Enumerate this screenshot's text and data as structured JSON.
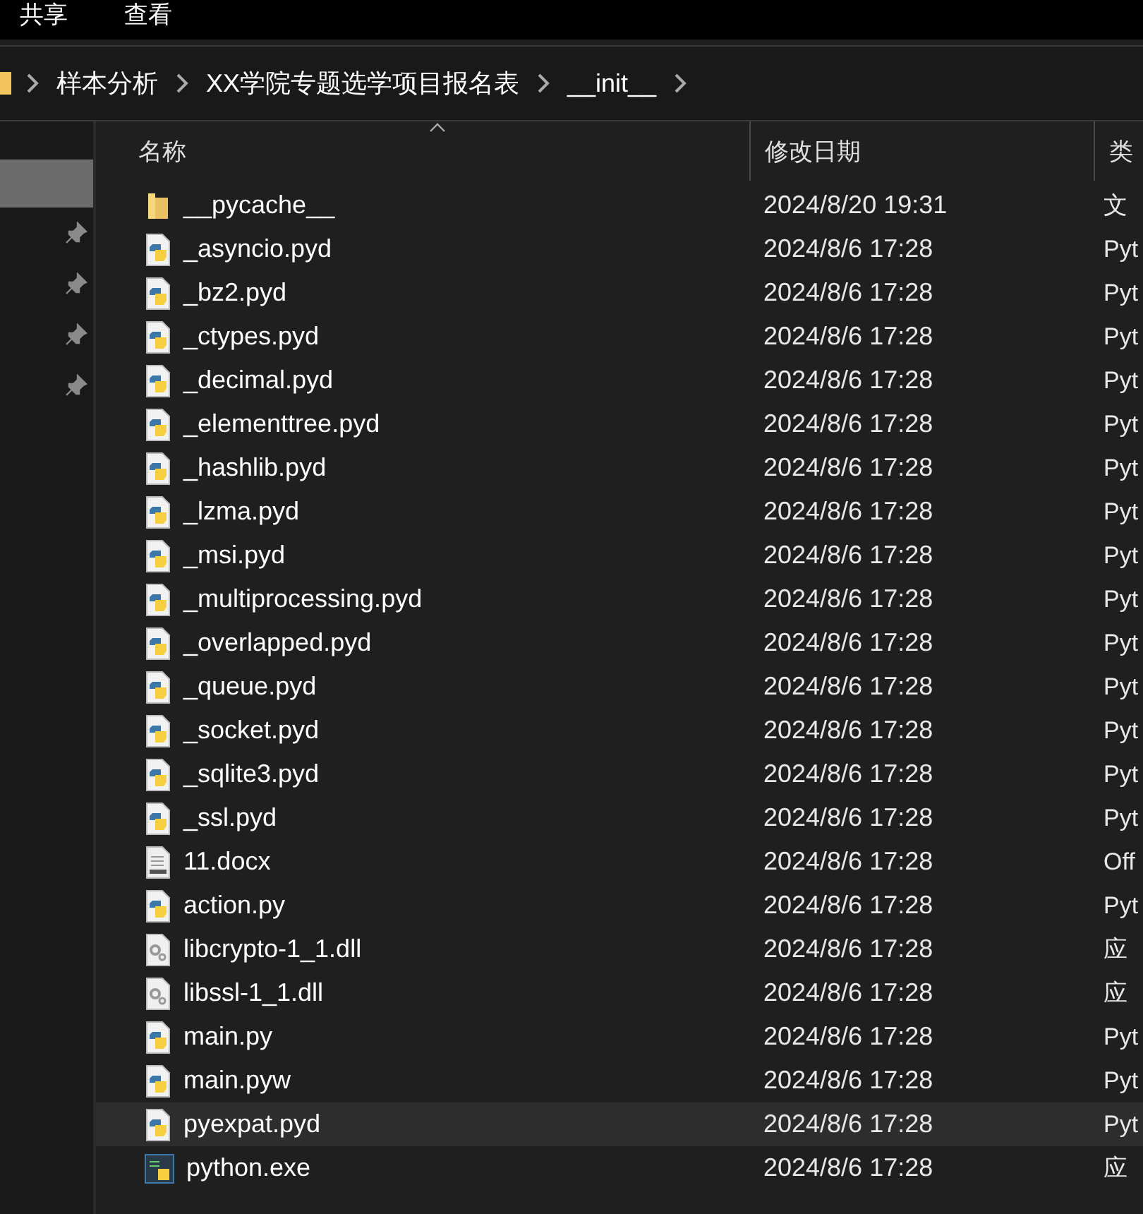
{
  "menu_bar": {
    "items": [
      "共享",
      "查看"
    ]
  },
  "breadcrumb": {
    "segments": [
      "样本分析",
      "XX学院专题选学项目报名表",
      "__init__"
    ]
  },
  "sidebar": {
    "items": [
      {
        "selected": true,
        "pinned": false
      },
      {
        "selected": false,
        "pinned": true
      },
      {
        "selected": false,
        "pinned": true
      },
      {
        "selected": false,
        "pinned": true
      },
      {
        "selected": false,
        "pinned": true
      }
    ]
  },
  "file_list": {
    "columns": [
      {
        "label": "名称",
        "sorted": true
      },
      {
        "label": "修改日期",
        "sorted": false
      },
      {
        "label": "类",
        "sorted": false
      }
    ],
    "rows": [
      {
        "kind": "folder",
        "name": "__pycache__",
        "modified": "2024/8/20 19:31",
        "type": "文",
        "selected": false
      },
      {
        "kind": "python",
        "name": "_asyncio.pyd",
        "modified": "2024/8/6 17:28",
        "type": "Pyt",
        "selected": false
      },
      {
        "kind": "python",
        "name": "_bz2.pyd",
        "modified": "2024/8/6 17:28",
        "type": "Pyt",
        "selected": false
      },
      {
        "kind": "python",
        "name": "_ctypes.pyd",
        "modified": "2024/8/6 17:28",
        "type": "Pyt",
        "selected": false
      },
      {
        "kind": "python",
        "name": "_decimal.pyd",
        "modified": "2024/8/6 17:28",
        "type": "Pyt",
        "selected": false
      },
      {
        "kind": "python",
        "name": "_elementtree.pyd",
        "modified": "2024/8/6 17:28",
        "type": "Pyt",
        "selected": false
      },
      {
        "kind": "python",
        "name": "_hashlib.pyd",
        "modified": "2024/8/6 17:28",
        "type": "Pyt",
        "selected": false
      },
      {
        "kind": "python",
        "name": "_lzma.pyd",
        "modified": "2024/8/6 17:28",
        "type": "Pyt",
        "selected": false
      },
      {
        "kind": "python",
        "name": "_msi.pyd",
        "modified": "2024/8/6 17:28",
        "type": "Pyt",
        "selected": false
      },
      {
        "kind": "python",
        "name": "_multiprocessing.pyd",
        "modified": "2024/8/6 17:28",
        "type": "Pyt",
        "selected": false
      },
      {
        "kind": "python",
        "name": "_overlapped.pyd",
        "modified": "2024/8/6 17:28",
        "type": "Pyt",
        "selected": false
      },
      {
        "kind": "python",
        "name": "_queue.pyd",
        "modified": "2024/8/6 17:28",
        "type": "Pyt",
        "selected": false
      },
      {
        "kind": "python",
        "name": "_socket.pyd",
        "modified": "2024/8/6 17:28",
        "type": "Pyt",
        "selected": false
      },
      {
        "kind": "python",
        "name": "_sqlite3.pyd",
        "modified": "2024/8/6 17:28",
        "type": "Pyt",
        "selected": false
      },
      {
        "kind": "python",
        "name": "_ssl.pyd",
        "modified": "2024/8/6 17:28",
        "type": "Pyt",
        "selected": false
      },
      {
        "kind": "document",
        "name": "11.docx",
        "modified": "2024/8/6 17:28",
        "type": "Off",
        "selected": false
      },
      {
        "kind": "python",
        "name": "action.py",
        "modified": "2024/8/6 17:28",
        "type": "Pyt",
        "selected": false
      },
      {
        "kind": "library",
        "name": "libcrypto-1_1.dll",
        "modified": "2024/8/6 17:28",
        "type": "应",
        "selected": false
      },
      {
        "kind": "library",
        "name": "libssl-1_1.dll",
        "modified": "2024/8/6 17:28",
        "type": "应",
        "selected": false
      },
      {
        "kind": "python",
        "name": "main.py",
        "modified": "2024/8/6 17:28",
        "type": "Pyt",
        "selected": false
      },
      {
        "kind": "python",
        "name": "main.pyw",
        "modified": "2024/8/6 17:28",
        "type": "Pyt",
        "selected": false
      },
      {
        "kind": "python",
        "name": "pyexpat.pyd",
        "modified": "2024/8/6 17:28",
        "type": "Pyt",
        "selected": true
      },
      {
        "kind": "program",
        "name": "python.exe",
        "modified": "2024/8/6 17:28",
        "type": "应",
        "selected": false
      }
    ]
  }
}
